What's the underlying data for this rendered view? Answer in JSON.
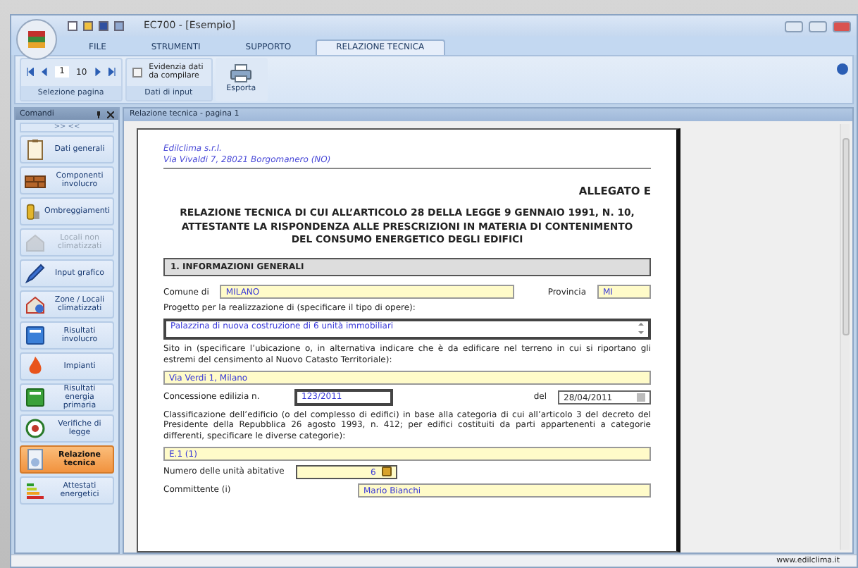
{
  "window": {
    "title": "EC700 - [Esempio]"
  },
  "ribbon_tabs": [
    {
      "label": "FILE",
      "selected": false
    },
    {
      "label": "STRUMENTI",
      "selected": false
    },
    {
      "label": "SUPPORTO",
      "selected": false
    },
    {
      "label": "RELAZIONE TECNICA",
      "selected": true
    }
  ],
  "page_selection": {
    "current": "1",
    "total": "10",
    "caption": "Selezione pagina"
  },
  "input_data": {
    "checkbox_label": "Evidenzia dati da compilare",
    "checked": false,
    "caption": "Dati di input"
  },
  "export": {
    "label": "Esporta"
  },
  "commands_panel": {
    "title": "Comandi",
    "collapse": ">> <<",
    "items": [
      {
        "label": "Dati generali",
        "selected": false,
        "disabled": false
      },
      {
        "label": "Componenti involucro",
        "selected": false,
        "disabled": false
      },
      {
        "label": "Ombreggiamenti",
        "selected": false,
        "disabled": false
      },
      {
        "label": "Locali non climatizzati",
        "selected": false,
        "disabled": true
      },
      {
        "label": "Input grafico",
        "selected": false,
        "disabled": false
      },
      {
        "label": "Zone / Locali climatizzati",
        "selected": false,
        "disabled": false
      },
      {
        "label": "Risultati involucro",
        "selected": false,
        "disabled": false
      },
      {
        "label": "Impianti",
        "selected": false,
        "disabled": false
      },
      {
        "label": "Risultati energia primaria",
        "selected": false,
        "disabled": false
      },
      {
        "label": "Verifiche di legge",
        "selected": false,
        "disabled": false
      },
      {
        "label": "Relazione tecnica",
        "selected": true,
        "disabled": false
      },
      {
        "label": "Attestati energetici",
        "selected": false,
        "disabled": false
      }
    ]
  },
  "document_tab": "Relazione tecnica - pagina 1",
  "document": {
    "company": [
      "Edilclima s.r.l.",
      "Via Vivaldi 7, 28021 Borgomanero (NO)"
    ],
    "annex": "ALLEGATO E",
    "title": "RELAZIONE TECNICA DI CUI ALL’ARTICOLO 28 DELLA LEGGE 9 GENNAIO 1991, N. 10, ATTESTANTE LA RISPONDENZA ALLE PRESCRIZIONI IN MATERIA DI CONTENIMENTO DEL CONSUMO ENERGETICO DEGLI EDIFICI",
    "section": "1.    INFORMAZIONI GENERALI",
    "rows": [
      {
        "kind": "pair",
        "label": "Comune di",
        "value": "MILANO",
        "label2": "Provincia",
        "value2": "MI"
      },
      {
        "kind": "text",
        "text": "Progetto per la realizzazione di (specificare il tipo di opere):"
      },
      {
        "kind": "memo",
        "value": "Palazzina di nuova costruzione di 6 unità immobiliari",
        "emphasized": true
      },
      {
        "kind": "text",
        "text": "Sito in (specificare l’ubicazione o, in alternativa indicare che è da edificare nel terreno in cui si riportano gli estremi del censimento al Nuovo Catasto Territoriale):"
      },
      {
        "kind": "field",
        "value": "Via Verdi 1, Milano",
        "emphasized": false
      },
      {
        "kind": "concession",
        "label": "Concessione edilizia n.",
        "value": "123/2011",
        "emphasized": true,
        "label2": "del",
        "value2": "28/04/2011"
      },
      {
        "kind": "text",
        "text": "Classificazione dell’edificio (o del complesso di edifici) in base alla categoria di cui all’articolo 3 del decreto del Presidente della Repubblica 26 agosto 1993, n. 412; per edifici costituiti da parti appartenenti a categorie differenti, specificare le diverse categorie):"
      },
      {
        "kind": "field",
        "value": "E.1 (1)",
        "emphasized": false
      },
      {
        "kind": "number",
        "label": "Numero delle unità abitative",
        "value": "6",
        "locked": true
      },
      {
        "kind": "person",
        "label": "Committente (i)",
        "value": "Mario Bianchi"
      }
    ]
  },
  "status_bar": {
    "url": "www.edilclima.it"
  }
}
